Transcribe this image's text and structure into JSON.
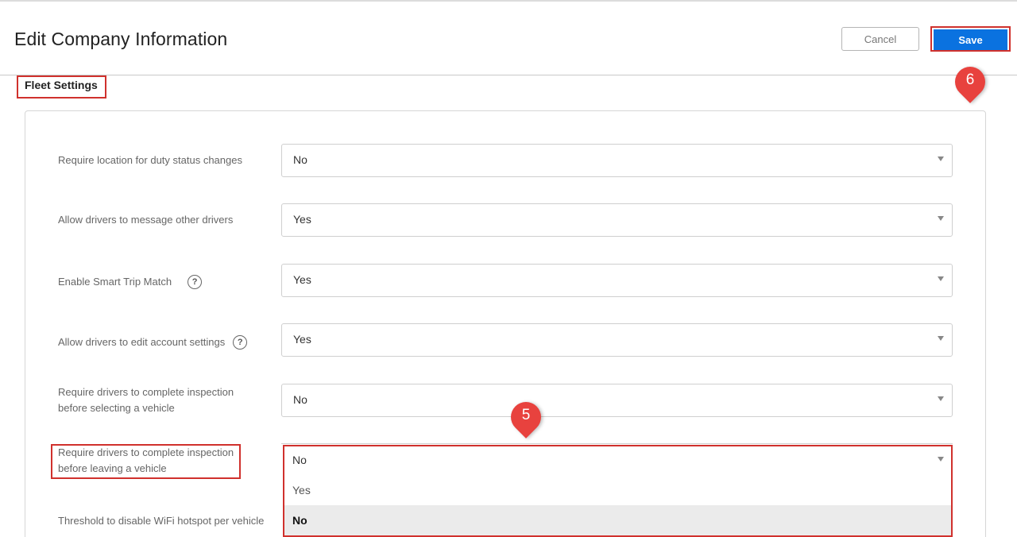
{
  "header": {
    "title": "Edit Company Information",
    "cancel_label": "Cancel",
    "save_label": "Save"
  },
  "section": {
    "title": "Fleet Settings"
  },
  "settings": [
    {
      "label": "Require location for duty status changes",
      "value": "No",
      "help": false
    },
    {
      "label": "Allow drivers to message other drivers",
      "value": "Yes",
      "help": false
    },
    {
      "label": "Enable Smart Trip Match",
      "value": "Yes",
      "help": true
    },
    {
      "label": "Allow drivers to edit account settings",
      "value": "Yes",
      "help": true
    },
    {
      "label_line1": "Require drivers to complete inspection",
      "label_line2": "before selecting a vehicle",
      "value": "No",
      "help": false
    },
    {
      "label_line1": "Require drivers to complete inspection",
      "label_line2": "before leaving a vehicle",
      "value": "No",
      "help": false,
      "open": true,
      "options": [
        "Yes",
        "No"
      ],
      "highlighted_option": "No"
    },
    {
      "label": "Threshold to disable WiFi hotspot per vehicle"
    }
  ],
  "icons": {
    "help": "question-circle-icon",
    "caret": "caret-down-icon"
  },
  "markers": {
    "step5": "5",
    "step6": "6"
  },
  "colors": {
    "accent": "#0a72e0",
    "highlight": "#d0312d",
    "marker": "#e8423e"
  }
}
